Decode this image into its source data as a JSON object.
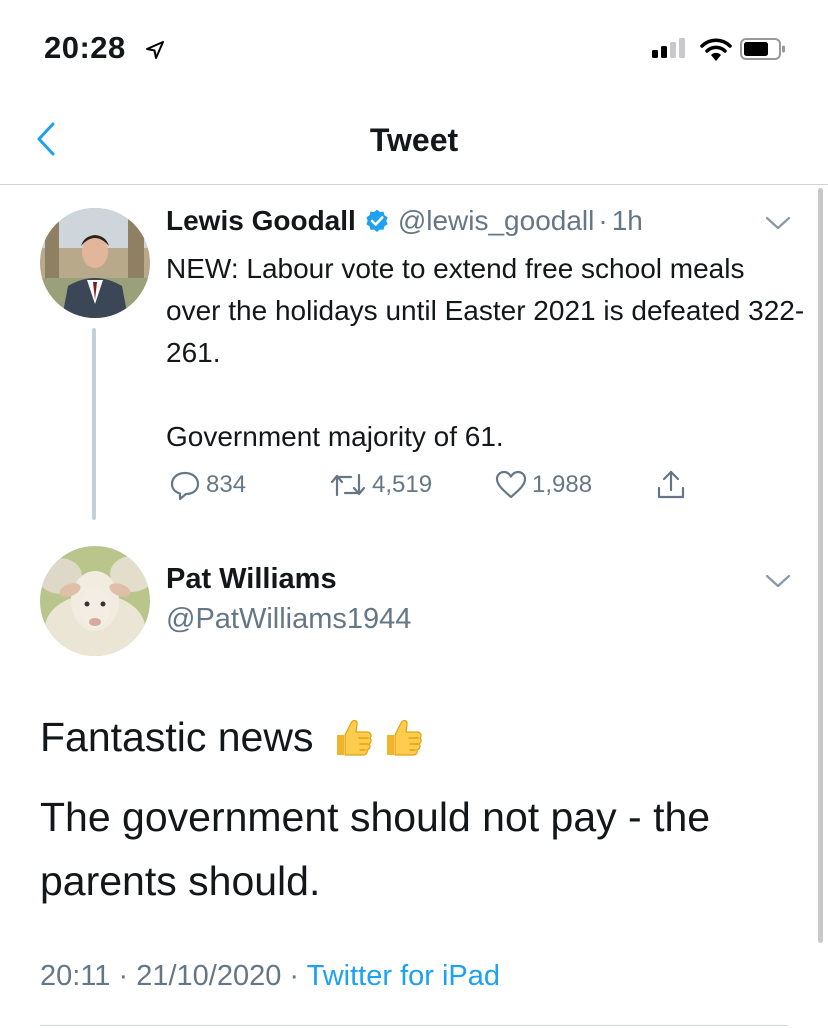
{
  "status_bar": {
    "time": "20:28",
    "location_icon": "location-arrow-icon",
    "signal_bars_active": 2,
    "signal_bars_total": 4,
    "wifi_icon": "wifi-icon",
    "battery_icon": "battery-icon"
  },
  "nav": {
    "title": "Tweet",
    "back_icon": "chevron-left-icon"
  },
  "quoted_tweet": {
    "name": "Lewis Goodall",
    "handle": "@lewis_goodall",
    "separator": "·",
    "time": "1h",
    "verified": true,
    "paragraphs": [
      "NEW: Labour vote to extend free school meals over the holidays until Easter 2021 is defeated 322-261.",
      "Government majority of 61."
    ],
    "actions": {
      "replies": "834",
      "retweets": "4,519",
      "likes": "1,988"
    }
  },
  "main_tweet": {
    "name": "Pat Williams",
    "handle": "@PatWilliams1944",
    "text_line1": "Fantastic news",
    "emoji": "👍👍",
    "text_line2": "The government should not pay - the parents should.",
    "timestamp": "20:11 · 21/10/2020",
    "meta_separator": "·",
    "source": "Twitter for iPad"
  },
  "colors": {
    "accent": "#1da1f2",
    "secondary_text": "#657786",
    "divider": "#ccd6dd"
  }
}
